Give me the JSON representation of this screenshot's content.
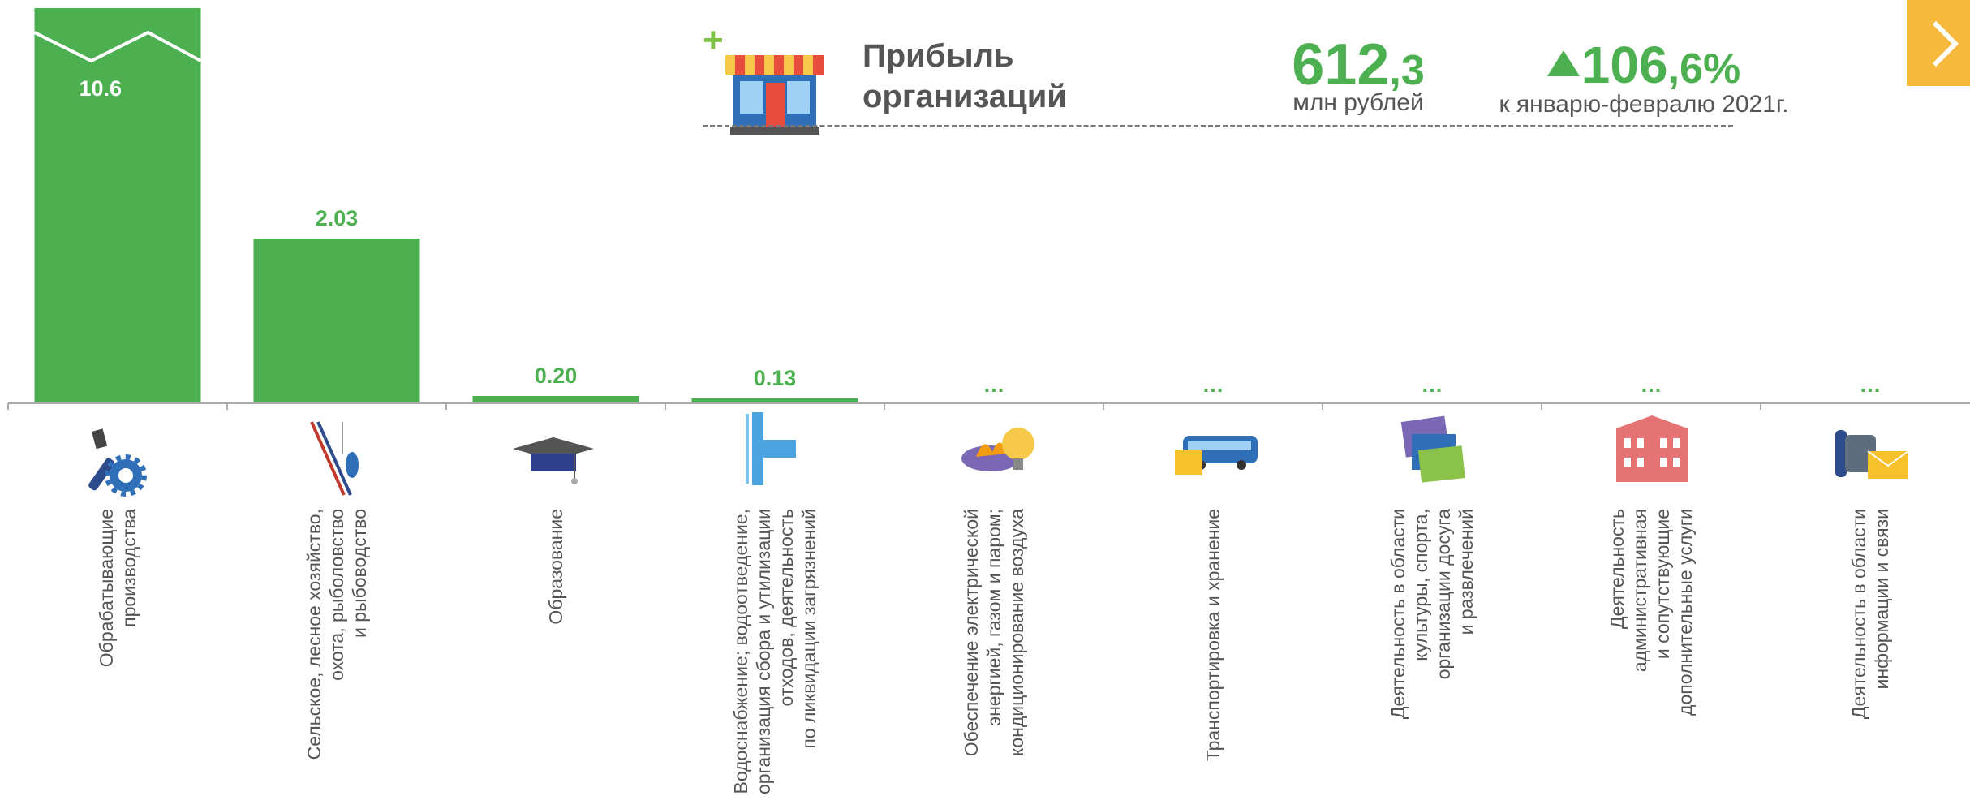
{
  "header": {
    "title_line1": "Прибыль",
    "title_line2": "организаций",
    "value_int": "612",
    "value_dec": ",3",
    "unit": "млн рублей",
    "growth_int": "106",
    "growth_dec": ",6%",
    "compare_text": "к январю-февралю 2021г.",
    "icon": "store-icon",
    "plus_icon": "plus-icon"
  },
  "nav": {
    "icon": "chevron-right-icon"
  },
  "colors": {
    "bar": "#4caf50",
    "text": "#555555",
    "accent": "#f6b93b",
    "axis": "#aaaaaa"
  },
  "chart_data": {
    "type": "bar",
    "categories": [
      "Обрабатывающие производства",
      "Сельское, лесное хозяйство, охота, рыболовство и рыбоводство",
      "Образование",
      "Водоснабжение; водоотведение, организация сбора и утилизации отходов, деятельность по ликвидации загрязнений",
      "Обеспечение электрической энергией, газом и паром; кондиционирование воздуха",
      "Транспортировка и хранение",
      "Деятельность в области культуры, спорта, организации досуга и развлечений",
      "Деятельность административная и сопутствующие дополнительные услуги",
      "Деятельность в области информации и связи"
    ],
    "category_lines": [
      [
        "Обрабатывающие",
        "производства"
      ],
      [
        "Сельское, лесное хозяйство,",
        "охота, рыболовство",
        "и рыбоводство"
      ],
      [
        "Образование"
      ],
      [
        "Водоснабжение; водоотведение,",
        "организация сбора и утилизации",
        "отходов, деятельность",
        "по ликвидации загрязнений"
      ],
      [
        "Обеспечение электрической",
        "энергией, газом и паром;",
        "кондиционирование воздуха"
      ],
      [
        "Транспортировка и хранение"
      ],
      [
        "Деятельность в области",
        "культуры, спорта,",
        "организации досуга",
        "и развлечений"
      ],
      [
        "Деятельность",
        "административная",
        "и сопутствующие",
        "дополнительные услуги"
      ],
      [
        "Деятельность в области",
        "информации и связи"
      ]
    ],
    "values": [
      10.6,
      2.03,
      0.2,
      0.13,
      null,
      null,
      null,
      null,
      null
    ],
    "value_labels": [
      "10.6",
      "2.03",
      "0.20",
      "0.13",
      "…",
      "…",
      "…",
      "…",
      "…"
    ],
    "icons": [
      "tools-icon",
      "fishing-rod-icon",
      "graduation-cap-icon",
      "water-pipe-icon",
      "gas-bulb-icon",
      "bus-icon",
      "theater-tickets-icon",
      "building-icon",
      "phone-mail-icon"
    ],
    "ylim": [
      0,
      2.5
    ],
    "broken_axis": true,
    "grid": false,
    "xlabel": "",
    "ylabel": ""
  }
}
